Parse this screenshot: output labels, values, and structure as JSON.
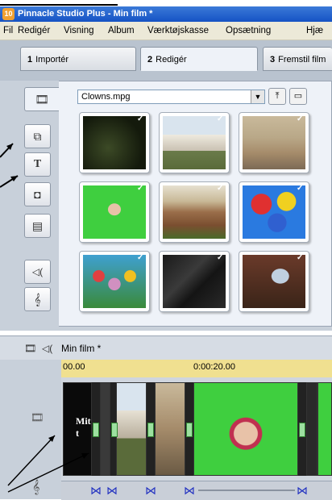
{
  "app": {
    "title": "Pinnacle Studio Plus - Min film *",
    "logo_text": "10"
  },
  "menu": [
    "Fil",
    "Redigér",
    "Visning",
    "Album",
    "Værktøjskasse",
    "Opsætning",
    "Hjæ"
  ],
  "tabs": [
    {
      "num": "1",
      "label": "Importér",
      "active": false
    },
    {
      "num": "2",
      "label": "Redigér",
      "active": true
    },
    {
      "num": "3",
      "label": "Fremstil film",
      "active": false
    }
  ],
  "toolbar": {
    "items": [
      {
        "icon": "video-album-icon",
        "glyph": "🎞"
      },
      {
        "icon": "transitions-icon",
        "glyph": "⧉"
      },
      {
        "icon": "titles-icon",
        "glyph": "T"
      },
      {
        "icon": "still-images-icon",
        "glyph": "◘"
      },
      {
        "icon": "disc-menus-icon",
        "glyph": "▤"
      },
      {
        "icon": "sound-effects-icon",
        "glyph": "◁("
      },
      {
        "icon": "music-icon",
        "glyph": "𝄞"
      }
    ]
  },
  "album": {
    "file_select_value": "Clowns.mpg",
    "dropdown_glyph": "▼",
    "folder_up_glyph": "⤒",
    "folder_glyph": "▭",
    "check_glyph": "✓"
  },
  "timeline": {
    "title": "Min film *",
    "ruler": [
      "00.00",
      "0:00:20.00"
    ],
    "first_clip_text": "Mit t"
  },
  "colors": {
    "accent_blue": "#1552c4",
    "menu_bg": "#ece9d8",
    "panel_bg": "#eef2f8",
    "ruler_yellow": "#f0e090",
    "green_screen": "#3fcf3f"
  }
}
